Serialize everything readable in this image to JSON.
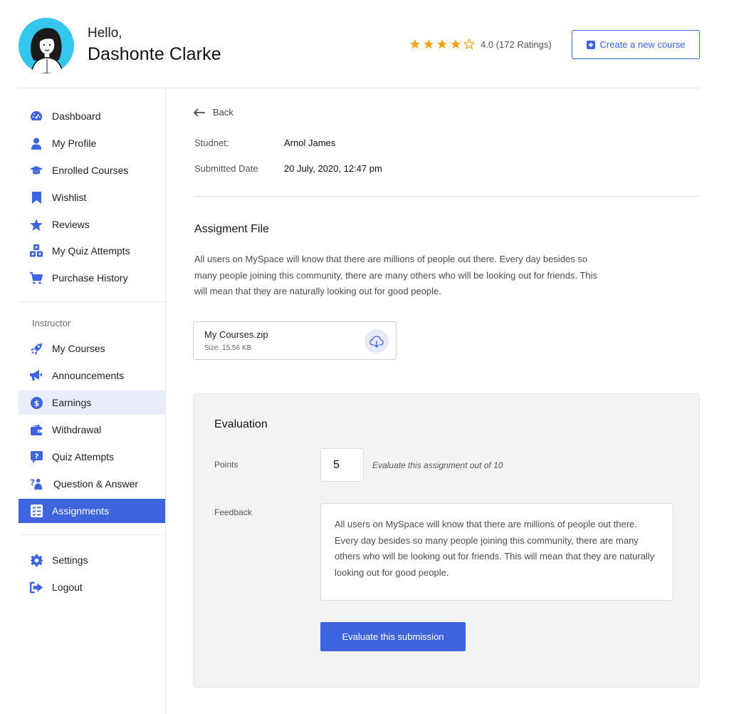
{
  "header": {
    "greeting": "Hello,",
    "user_name": "Dashonte Clarke",
    "rating_value": 4.0,
    "rating_max": 5,
    "rating_text": "4.0 (172 Ratings)",
    "create_button_label": "Create a new course"
  },
  "sidebar": {
    "items": [
      {
        "label": "Dashboard",
        "icon": "dashboard-gauge-icon"
      },
      {
        "label": "My Profile",
        "icon": "user-icon"
      },
      {
        "label": "Enrolled Courses",
        "icon": "graduation-cap-icon"
      },
      {
        "label": "Wishlist",
        "icon": "bookmark-icon"
      },
      {
        "label": "Reviews",
        "icon": "star-icon"
      },
      {
        "label": "My Quiz Attempts",
        "icon": "cubes-icon"
      },
      {
        "label": "Purchase History",
        "icon": "cart-icon"
      }
    ],
    "instructor_heading": "Instructor",
    "instructor_items": [
      {
        "label": "My Courses",
        "icon": "rocket-icon"
      },
      {
        "label": "Announcements",
        "icon": "megaphone-icon"
      },
      {
        "label": "Earnings",
        "icon": "dollar-coin-icon"
      },
      {
        "label": "Withdrawal",
        "icon": "wallet-icon"
      },
      {
        "label": "Quiz Attempts",
        "icon": "question-box-icon"
      },
      {
        "label": "Question & Answer",
        "icon": "question-person-icon"
      },
      {
        "label": "Assignments",
        "icon": "checklist-icon"
      }
    ],
    "bottom_items": [
      {
        "label": "Settings",
        "icon": "gear-icon"
      },
      {
        "label": "Logout",
        "icon": "logout-icon"
      }
    ],
    "active_item": "Assignments",
    "hover_item": "Earnings"
  },
  "main": {
    "back_label": "Back",
    "student_label": "Studnet:",
    "student_name": "Arnol James",
    "submitted_label": "Submitted Date",
    "submitted_date": "20 July, 2020, 12:47 pm",
    "file_section_title": "Assigment File",
    "description": "All users on MySpace will know that there are millions of people out there. Every day besides so many people joining this community, there are many others who will be looking out for friends. This will mean that they are naturally looking out for good people.",
    "file": {
      "name": "My Courses.zip",
      "size": "Size: 15.56 KB"
    }
  },
  "evaluation": {
    "title": "Evaluation",
    "points_label": "Points",
    "points_value": "5",
    "points_hint": "Evaluate this assignment out of 10",
    "feedback_label": "Feedback",
    "feedback_text": "All users on MySpace will know that there are millions of people out there. Every day besides so many people joining this community, there are many others who will be looking out for friends. This will mean that they are naturally looking out for good people.",
    "submit_label": "Evaluate this submission"
  },
  "colors": {
    "accent": "#3e64de",
    "star": "#f4a014",
    "hover_bg": "#e9ecfb",
    "card_bg": "#f3f3f3"
  }
}
